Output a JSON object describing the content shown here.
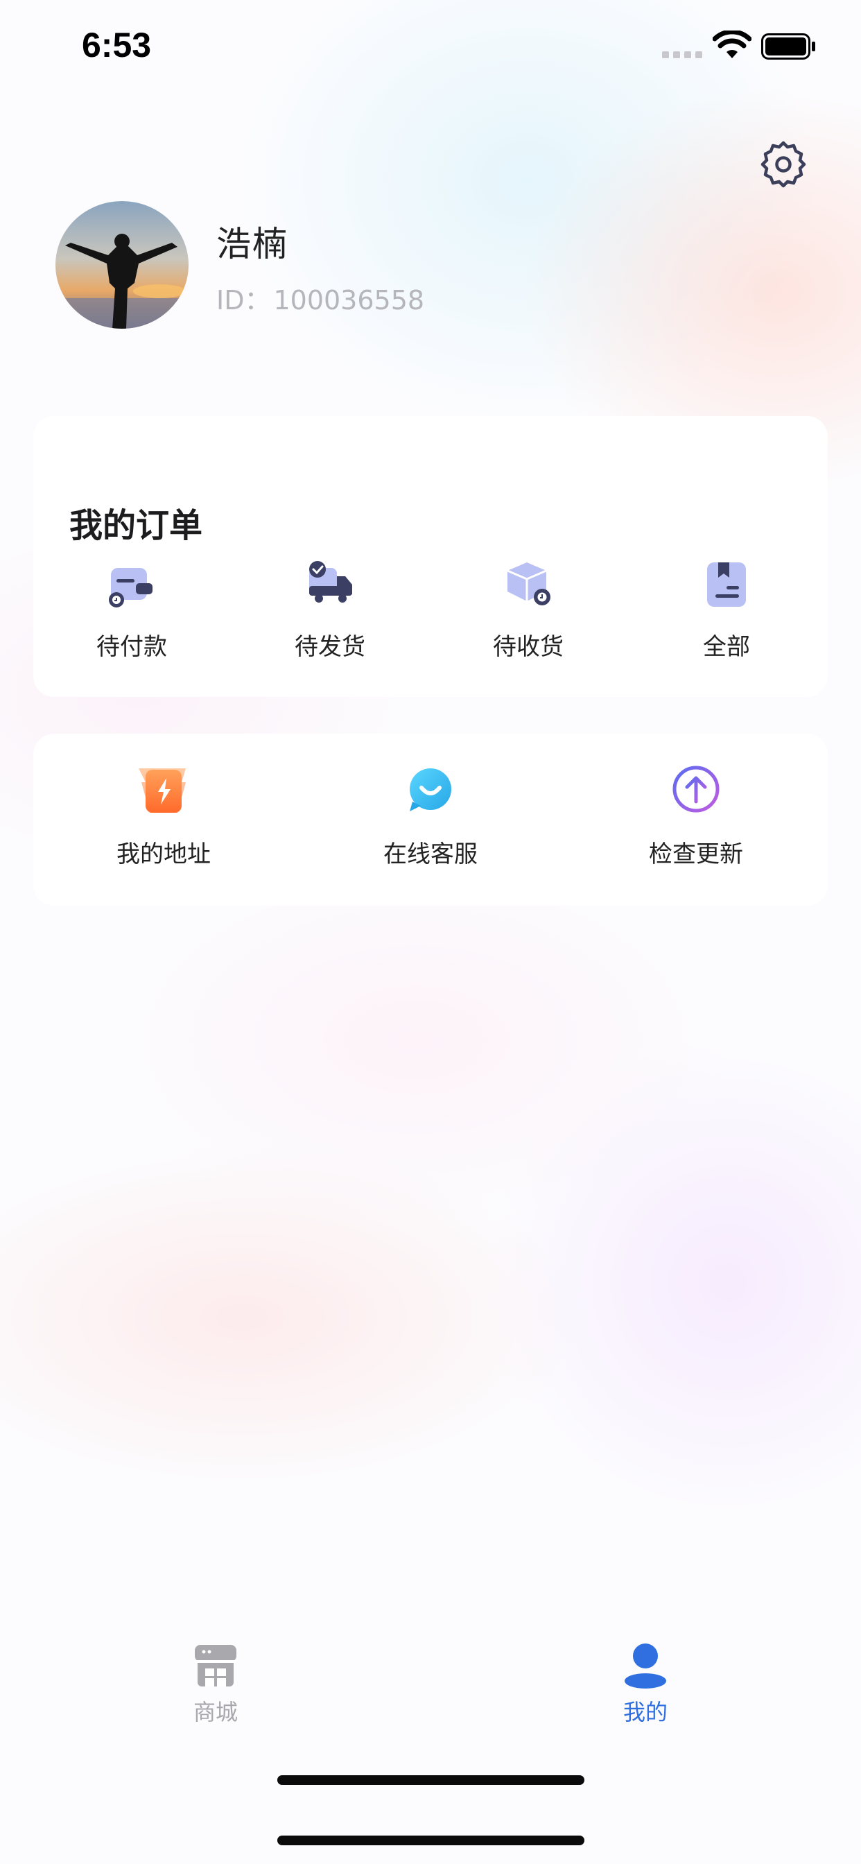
{
  "status_bar": {
    "time": "6:53"
  },
  "profile": {
    "name": "浩楠",
    "id_label": "ID：",
    "id_value": "100036558"
  },
  "orders": {
    "title": "我的订单",
    "items": [
      {
        "label": "待付款",
        "icon": "wallet-icon"
      },
      {
        "label": "待发货",
        "icon": "delivery-truck-icon"
      },
      {
        "label": "待收货",
        "icon": "package-box-icon"
      },
      {
        "label": "全部",
        "icon": "document-list-icon"
      }
    ]
  },
  "services": {
    "items": [
      {
        "label": "我的地址",
        "icon": "address-flash-icon"
      },
      {
        "label": "在线客服",
        "icon": "chat-smile-icon"
      },
      {
        "label": "检查更新",
        "icon": "upload-arrow-circle-icon"
      }
    ]
  },
  "tab_bar": {
    "items": [
      {
        "label": "商城",
        "icon": "store-icon",
        "active": false
      },
      {
        "label": "我的",
        "icon": "person-icon",
        "active": true
      }
    ]
  },
  "colors": {
    "accent_blue": "#2f6fe0",
    "icon_dark": "#3b3f63",
    "icon_light": "#b9c0f4",
    "orange": "#ff7a2f",
    "cyan": "#39c3f2",
    "purple": "#8d62e8"
  }
}
